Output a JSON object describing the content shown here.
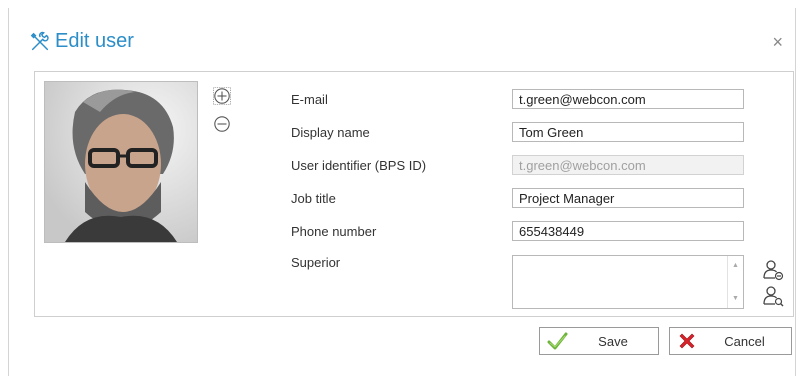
{
  "dialog": {
    "title": "Edit user",
    "title_icon": "tools-icon",
    "close_glyph": "×"
  },
  "photo": {
    "description_icon": "user-photo"
  },
  "photo_controls": {
    "add_icon": "plus-circle-icon",
    "remove_icon": "minus-circle-icon"
  },
  "form": {
    "email_label": "E-mail",
    "email_value": "t.green@webcon.com",
    "display_name_label": "Display name",
    "display_name_value": "Tom Green",
    "user_id_label": "User identifier (BPS ID)",
    "user_id_value": "t.green@webcon.com",
    "job_title_label": "Job title",
    "job_title_value": "Project Manager",
    "phone_label": "Phone number",
    "phone_value": "655438449",
    "superior_label": "Superior",
    "superior_value": ""
  },
  "buttons": {
    "save_label": "Save",
    "cancel_label": "Cancel"
  },
  "colors": {
    "accent": "#2c8ec9",
    "save_check": "#6bb33a",
    "cancel_x": "#d8232a"
  }
}
